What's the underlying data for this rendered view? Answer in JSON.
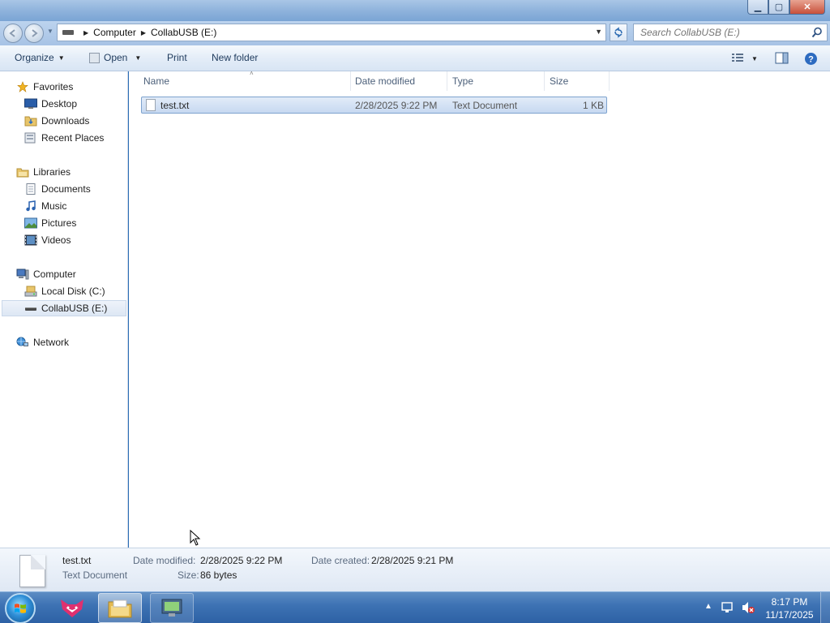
{
  "window": {
    "buttons": {
      "minimize": "▁",
      "maximize": "▢",
      "close": "✕"
    }
  },
  "address": {
    "breadcrumbs": [
      "Computer",
      "CollabUSB (E:)"
    ],
    "search_placeholder": "Search CollabUSB (E:)"
  },
  "toolbar": {
    "organize": "Organize",
    "open": "Open",
    "print": "Print",
    "new_folder": "New folder"
  },
  "nav": {
    "favorites": "Favorites",
    "desktop": "Desktop",
    "downloads": "Downloads",
    "recent_places": "Recent Places",
    "libraries": "Libraries",
    "documents": "Documents",
    "music": "Music",
    "pictures": "Pictures",
    "videos": "Videos",
    "computer": "Computer",
    "local_disk": "Local Disk (C:)",
    "collabusb": "CollabUSB (E:)",
    "network": "Network"
  },
  "columns": {
    "name": "Name",
    "date_modified": "Date modified",
    "type": "Type",
    "size": "Size"
  },
  "files": [
    {
      "name": "test.txt",
      "date_modified": "2/28/2025 9:22 PM",
      "type": "Text Document",
      "size": "1 KB"
    }
  ],
  "details": {
    "filename": "test.txt",
    "filetype": "Text Document",
    "date_modified_label": "Date modified:",
    "date_modified": "2/28/2025 9:22 PM",
    "date_created_label": "Date created:",
    "date_created": "2/28/2025 9:21 PM",
    "size_label": "Size:",
    "size": "86 bytes"
  },
  "taskbar": {
    "time": "8:17 PM",
    "date": "11/17/2025"
  }
}
